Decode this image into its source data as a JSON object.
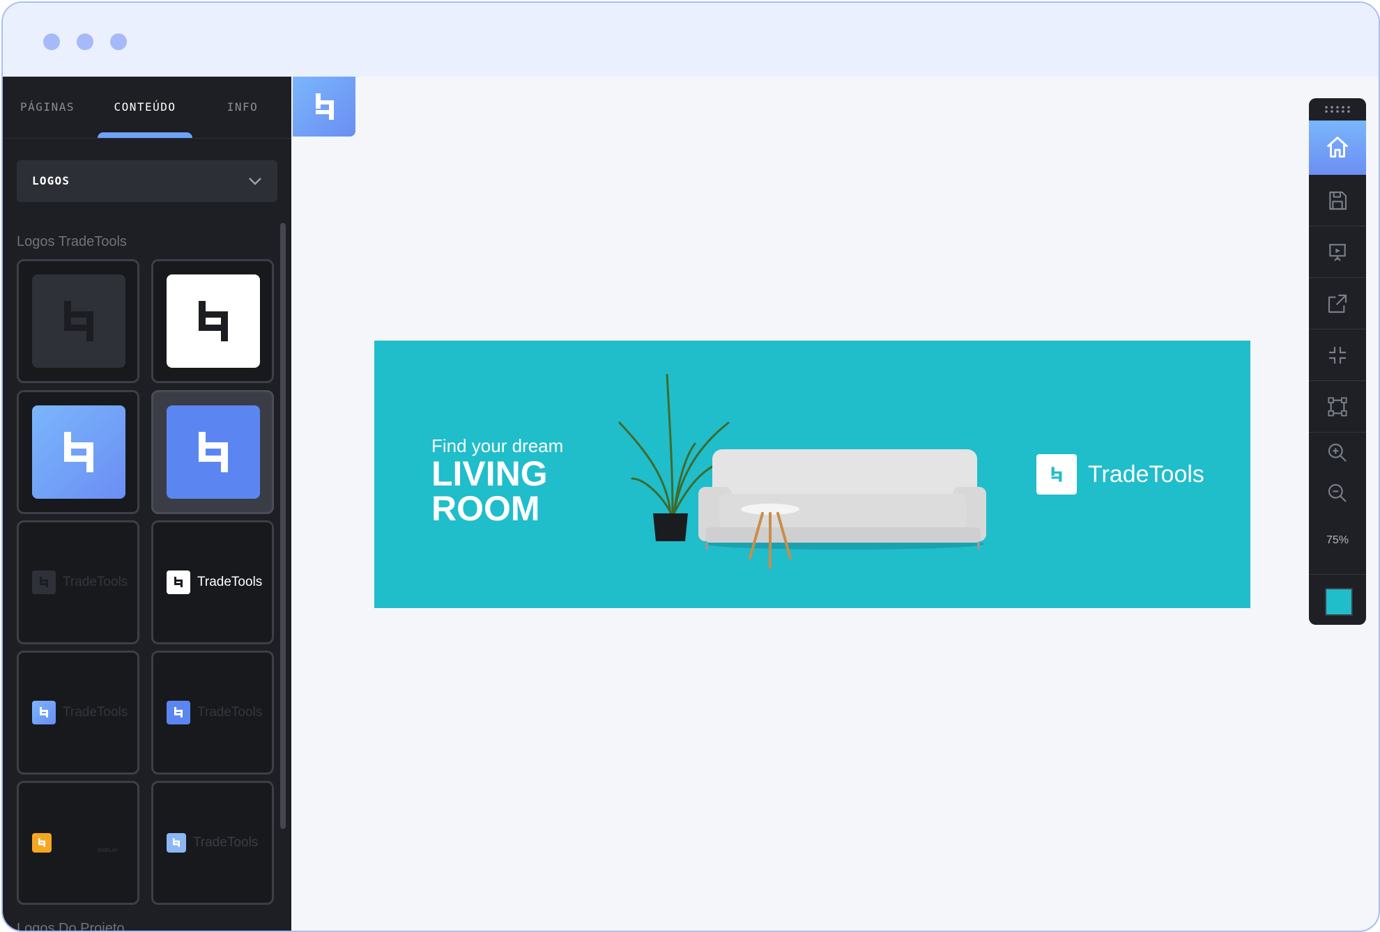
{
  "window": {
    "traffic_lights": [
      "close",
      "minimize",
      "maximize"
    ]
  },
  "sidebar": {
    "tabs": [
      {
        "label": "PÁGINAS",
        "active": false
      },
      {
        "label": "CONTEÚDO",
        "active": true
      },
      {
        "label": "INFO",
        "active": false
      }
    ],
    "dropdown": {
      "selected": "LOGOS"
    },
    "section_tradetools": "Logos TradeTools",
    "section_project": "Logos Do Projeto",
    "logo_tiles": [
      {
        "variant": "dark-square"
      },
      {
        "variant": "white-square"
      },
      {
        "variant": "gradient-square"
      },
      {
        "variant": "blue-square",
        "selected": true
      },
      {
        "variant": "dark-horizontal",
        "word": "TradeTools"
      },
      {
        "variant": "white-horizontal",
        "word": "TradeTools"
      },
      {
        "variant": "gradient-horizontal",
        "word": "TradeTools"
      },
      {
        "variant": "blue-horizontal",
        "word": "TradeTools"
      },
      {
        "variant": "orange-horizontal",
        "word": "DISPLAY"
      },
      {
        "variant": "pale-horizontal",
        "word": "TradeTools"
      }
    ]
  },
  "canvas": {
    "banner": {
      "headline_small": "Find your dream",
      "headline_line1": "LIVING",
      "headline_line2": "ROOM",
      "logo_word": "TradeTools",
      "background": "#20bdcb"
    }
  },
  "toolbar": {
    "buttons": [
      "home-icon",
      "save-icon",
      "presentation-icon",
      "external-link-icon",
      "collapse-icon",
      "artboard-icon",
      "zoom-in-icon",
      "zoom-out-icon"
    ],
    "zoom_level": "75%",
    "active_color": "#20bdcb"
  },
  "colors": {
    "accent": "#6b8ef4",
    "accent_light": "#7ab6fb",
    "sidebar_bg": "#1e1f24",
    "titlebar_bg": "#ebf0fe"
  }
}
